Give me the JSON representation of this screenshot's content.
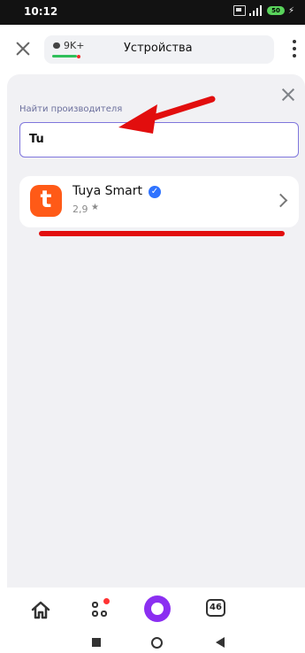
{
  "status_bar": {
    "time": "10:12",
    "battery_level": "50"
  },
  "header": {
    "comments_count": "9K+",
    "title": "Устройства"
  },
  "search": {
    "label": "Найти производителя",
    "value": "Tu"
  },
  "result": {
    "logo_letter": "t",
    "name": "Tuya Smart",
    "rating": "2,9"
  },
  "bottom_nav": {
    "tabs_count": "46"
  },
  "colors": {
    "accent": "#7f76dc",
    "brand_logo": "#ff5a17",
    "annotation_red": "#e20e0e",
    "alice_purple": "#8b2ff1",
    "verified_blue": "#2f73ff"
  },
  "icons": {
    "status": [
      "sim-icon",
      "signal-icon",
      "battery-icon",
      "charge-icon"
    ],
    "header": [
      "close-icon",
      "comments-icon",
      "more-icon"
    ],
    "content": [
      "close-icon",
      "verified-icon",
      "star-icon",
      "chevron-right-icon"
    ],
    "bottom_nav": [
      "home-icon",
      "services-icon",
      "alice-icon",
      "tabs-icon"
    ],
    "system_nav": [
      "recent-apps-icon",
      "home-button-icon",
      "back-icon"
    ]
  }
}
